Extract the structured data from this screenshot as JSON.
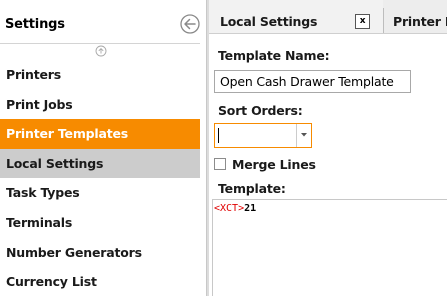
{
  "settings_panel": {
    "title": "Settings",
    "back_icon": "circle-arrow-left-icon",
    "scroll_up_icon": "circle-chevron-up-icon",
    "items": [
      {
        "label": "Printers",
        "state": "normal"
      },
      {
        "label": "Print Jobs",
        "state": "normal"
      },
      {
        "label": "Printer Templates",
        "state": "active"
      },
      {
        "label": "Local Settings",
        "state": "selected"
      },
      {
        "label": "Task Types",
        "state": "normal"
      },
      {
        "label": "Terminals",
        "state": "normal"
      },
      {
        "label": "Number Generators",
        "state": "normal"
      },
      {
        "label": "Currency List",
        "state": "normal"
      }
    ]
  },
  "tabs": [
    {
      "label": "Local Settings",
      "close_label": "x"
    },
    {
      "label": "Printer L"
    }
  ],
  "form": {
    "template_name_label": "Template Name:",
    "template_name_value": "Open Cash Drawer Template",
    "sort_orders_label": "Sort Orders:",
    "sort_orders_value": "",
    "merge_lines_label": "Merge Lines",
    "merge_lines_checked": false,
    "template_label": "Template:",
    "template_tag": "<XCT>",
    "template_value": "21"
  },
  "colors": {
    "accent": "#f78b00",
    "selected_bg": "#cccccc",
    "tag_color": "#e00000"
  }
}
